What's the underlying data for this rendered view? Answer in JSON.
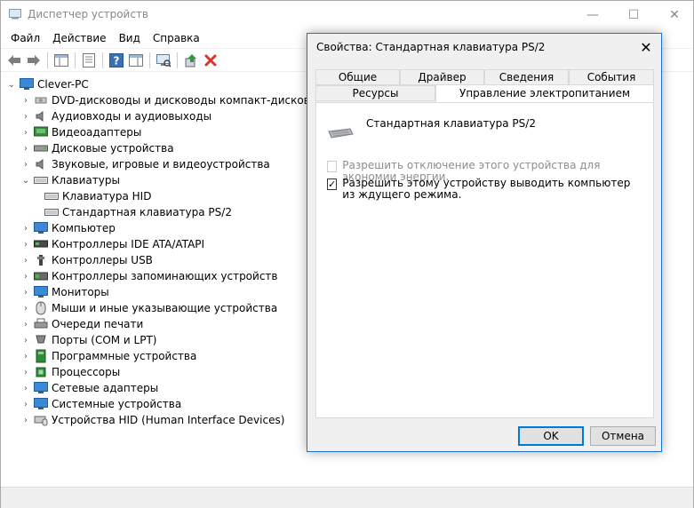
{
  "window": {
    "title": "Диспетчер устройств",
    "controls": {
      "minimize": "—",
      "maximize": "☐",
      "close": "✕"
    }
  },
  "menu": [
    "Файл",
    "Действие",
    "Вид",
    "Справка"
  ],
  "toolbar_icons": [
    "back-arrow-icon",
    "forward-arrow-icon",
    "show-hide-tree-icon",
    "properties-icon",
    "help-icon",
    "action-pane-icon",
    "scan-hardware-icon",
    "update-driver-icon",
    "uninstall-device-icon"
  ],
  "tree": {
    "root": "Clever-PC",
    "categories": [
      {
        "label": "DVD-дисководы и дисководы компакт-дисков",
        "icon": "dvd-drive-icon",
        "expanded": false
      },
      {
        "label": "Аудиовходы и аудиовыходы",
        "icon": "speaker-icon",
        "expanded": false
      },
      {
        "label": "Видеоадаптеры",
        "icon": "display-adapter-icon",
        "expanded": false
      },
      {
        "label": "Дисковые устройства",
        "icon": "disk-drive-icon",
        "expanded": false
      },
      {
        "label": "Звуковые, игровые и видеоустройства",
        "icon": "speaker-icon",
        "expanded": false
      },
      {
        "label": "Клавиатуры",
        "icon": "keyboard-icon",
        "expanded": true,
        "children": [
          "Клавиатура HID",
          "Стандартная клавиатура PS/2"
        ]
      },
      {
        "label": "Компьютер",
        "icon": "computer-icon",
        "expanded": false
      },
      {
        "label": "Контроллеры IDE ATA/ATAPI",
        "icon": "ide-controller-icon",
        "expanded": false
      },
      {
        "label": "Контроллеры USB",
        "icon": "usb-icon",
        "expanded": false
      },
      {
        "label": "Контроллеры запоминающих устройств",
        "icon": "storage-controller-icon",
        "expanded": false
      },
      {
        "label": "Мониторы",
        "icon": "monitor-icon",
        "expanded": false
      },
      {
        "label": "Мыши и иные указывающие устройства",
        "icon": "mouse-icon",
        "expanded": false
      },
      {
        "label": "Очереди печати",
        "icon": "printer-icon",
        "expanded": false
      },
      {
        "label": "Порты (COM и LPT)",
        "icon": "port-icon",
        "expanded": false
      },
      {
        "label": "Программные устройства",
        "icon": "software-device-icon",
        "expanded": false
      },
      {
        "label": "Процессоры",
        "icon": "processor-icon",
        "expanded": false
      },
      {
        "label": "Сетевые адаптеры",
        "icon": "network-adapter-icon",
        "expanded": false
      },
      {
        "label": "Системные устройства",
        "icon": "system-device-icon",
        "expanded": false
      },
      {
        "label": "Устройства HID (Human Interface Devices)",
        "icon": "hid-icon",
        "expanded": false
      }
    ]
  },
  "dialog": {
    "title": "Свойства: Стандартная клавиатура PS/2",
    "close": "✕",
    "tabs_row1": [
      "Общие",
      "Драйвер",
      "Сведения",
      "События"
    ],
    "tabs_row2": [
      "Ресурсы",
      "Управление электропитанием"
    ],
    "active_tab": "Управление электропитанием",
    "device_name": "Стандартная клавиатура PS/2",
    "options": [
      {
        "label": "Разрешить отключение этого устройства для экономии энергии.",
        "checked": false,
        "disabled": true
      },
      {
        "label": "Разрешить этому устройству выводить компьютер из ждущего режима.",
        "checked": true,
        "disabled": false
      }
    ],
    "ok": "OK",
    "cancel": "Отмена"
  },
  "colors": {
    "accent": "#0078d7",
    "dialog_border": "#1e73c8",
    "disabled_text": "#8d8d8d",
    "uninstall_red": "#d9342b"
  }
}
